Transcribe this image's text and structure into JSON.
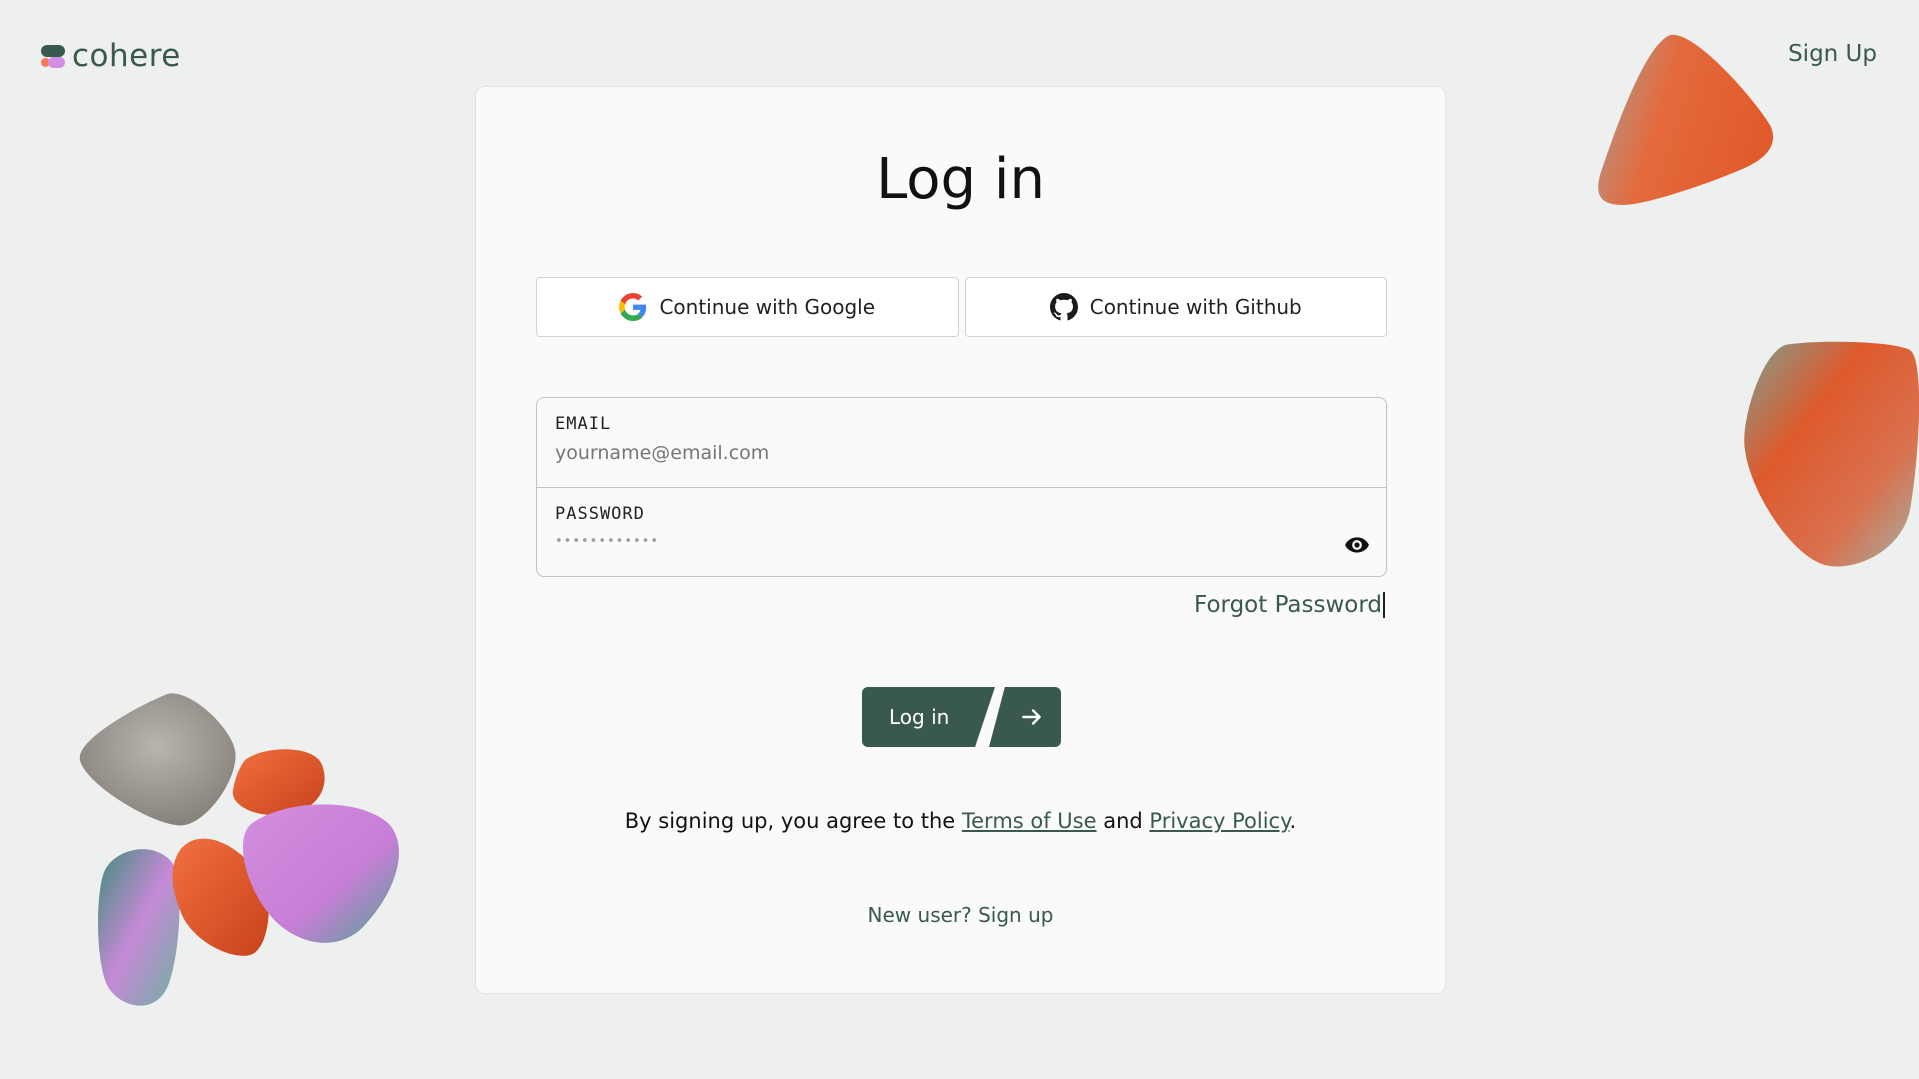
{
  "header": {
    "logo_text": "cohere",
    "signup_label": "Sign Up"
  },
  "card": {
    "title": "Log in",
    "google_label": "Continue with Google",
    "github_label": "Continue with Github",
    "email": {
      "label": "EMAIL",
      "placeholder": "yourname@email.com",
      "value": ""
    },
    "password": {
      "label": "PASSWORD",
      "masked_value": "••••••••••••"
    },
    "forgot_label": "Forgot Password",
    "login_label": "Log in",
    "terms_prefix": "By signing up, you agree to the ",
    "terms_link": "Terms of Use",
    "terms_and": " and ",
    "privacy_link": "Privacy Policy",
    "terms_suffix": ".",
    "new_user_prefix": "New user? ",
    "new_user_link": "Sign up"
  },
  "icons": {
    "google": "google-icon",
    "github": "github-icon",
    "eye": "eye-icon",
    "arrow": "arrow-right-icon"
  },
  "colors": {
    "brand": "#39594d",
    "background": "#eef0ef",
    "card": "#fafafa",
    "accent_orange": "#ff7759",
    "accent_purple": "#d18ee2"
  }
}
